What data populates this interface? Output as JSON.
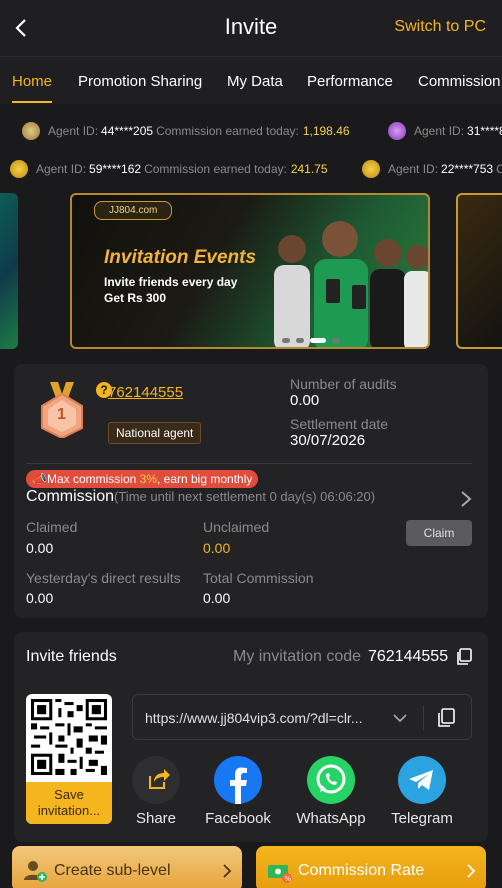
{
  "header": {
    "title": "Invite",
    "switch_label": "Switch to PC"
  },
  "tabs": [
    "Home",
    "Promotion Sharing",
    "My Data",
    "Performance",
    "Commission"
  ],
  "ticker": {
    "row1": [
      {
        "label": "Agent ID:",
        "id": "44****205",
        "earned_label": "Commission earned today:",
        "amount": "1,198.46"
      },
      {
        "label": "Agent ID:",
        "id": "31****8",
        "earned_label": "",
        "amount": ""
      }
    ],
    "row2": [
      {
        "label": "Agent ID:",
        "id": "59****162",
        "earned_label": "Commission earned today:",
        "amount": "241.75"
      },
      {
        "label": "Agent ID:",
        "id": "22****753",
        "earned_label": "C",
        "amount": ""
      }
    ]
  },
  "banner": {
    "logo": "JJ804.com",
    "heading": "Invitation Events",
    "line1": "Invite friends every day",
    "line2": "Get Rs 300"
  },
  "agent": {
    "rank": "1",
    "id": "762144555",
    "badge": "National agent",
    "audits_label": "Number of audits",
    "audits_value": "0.00",
    "settlement_label": "Settlement date",
    "settlement_value": "30/07/2026"
  },
  "commission": {
    "promo_pre": "Max commission ",
    "promo_pct": "3%",
    "promo_post": ", earn big monthly",
    "title": "Commission",
    "subtitle": "(Time until next settlement  0 day(s) 06:06:20)",
    "claimed_label": "Claimed",
    "claimed_value": "0.00",
    "unclaimed_label": "Unclaimed",
    "unclaimed_value": "0.00",
    "claim_button": "Claim",
    "yesterday_label": "Yesterday's direct results",
    "yesterday_value": "0.00",
    "total_label": "Total Commission",
    "total_value": "0.00"
  },
  "invite": {
    "title": "Invite friends",
    "code_label": "My invitation code",
    "code_value": "762144555",
    "save_label": "Save invitation...",
    "url": "https://www.jj804vip3.com/?dl=clr...",
    "share": [
      {
        "label": "Share",
        "icon": "share-icon",
        "color": "#2e2e30"
      },
      {
        "label": "Facebook",
        "icon": "facebook-icon",
        "color": "#1877f2"
      },
      {
        "label": "WhatsApp",
        "icon": "whatsapp-icon",
        "color": "#25d366"
      },
      {
        "label": "Telegram",
        "icon": "telegram-icon",
        "color": "#2aa3e0"
      }
    ]
  },
  "bottom": {
    "create_label": "Create sub-level",
    "rate_label": "Commission Rate"
  },
  "colors": {
    "accent": "#f5b51e",
    "background": "#1a1a1c",
    "card": "#232325"
  }
}
